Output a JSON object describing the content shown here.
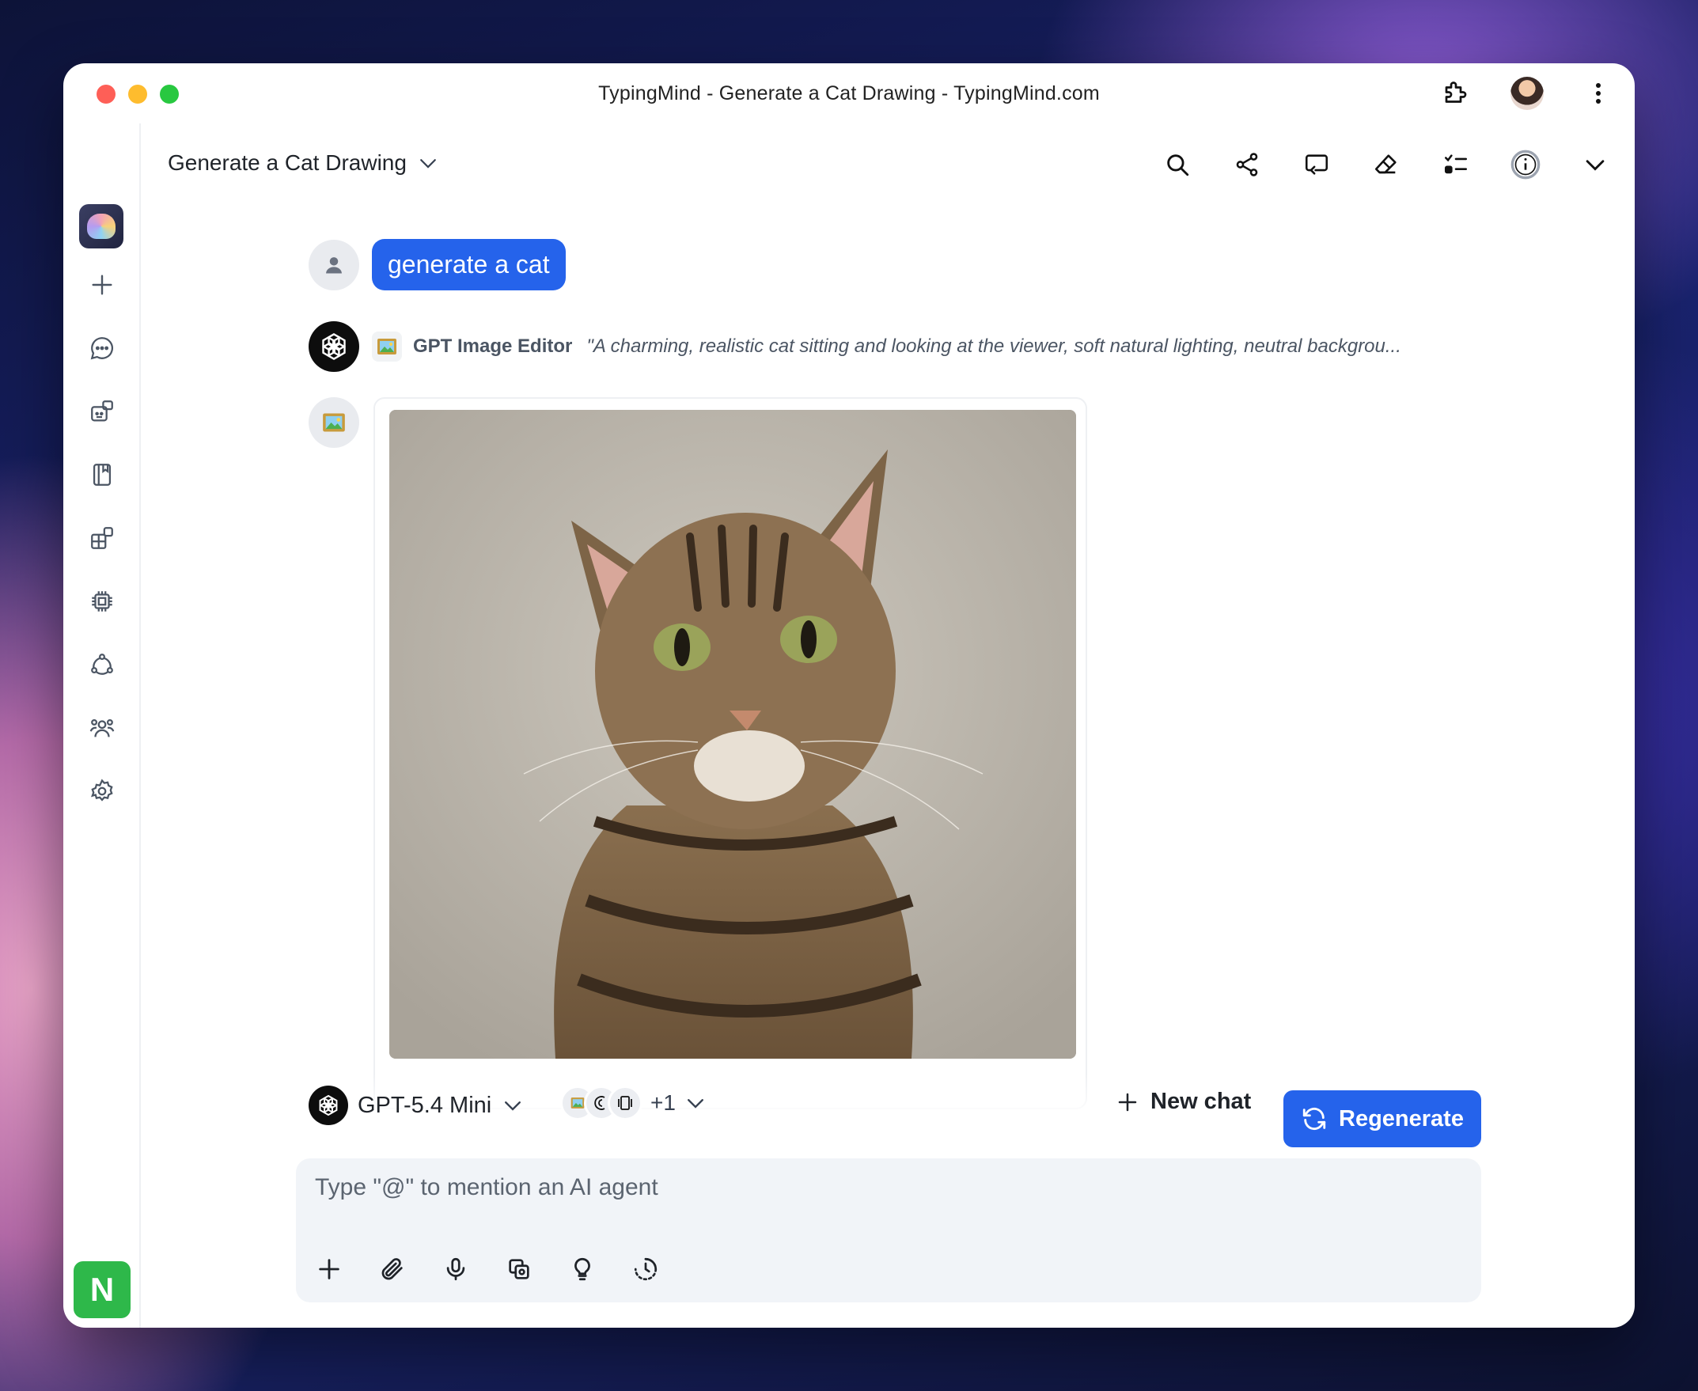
{
  "window": {
    "title": "TypingMind - Generate a Cat Drawing - TypingMind.com"
  },
  "titlebar_icons": [
    "extension-icon",
    "profile-avatar",
    "more-vertical-icon"
  ],
  "sidebar": {
    "items": [
      {
        "name": "new-chat-icon"
      },
      {
        "name": "chats-icon"
      },
      {
        "name": "agents-icon"
      },
      {
        "name": "prompt-library-icon"
      },
      {
        "name": "plugins-icon"
      },
      {
        "name": "models-icon"
      },
      {
        "name": "workflows-icon"
      },
      {
        "name": "team-icon"
      },
      {
        "name": "settings-icon"
      }
    ],
    "user_initial": "N",
    "user_color": "#2eb84a"
  },
  "header": {
    "chat_title": "Generate a Cat Drawing",
    "tools": [
      "search-icon",
      "share-icon",
      "reply-icon",
      "eraser-icon",
      "checklist-icon",
      "info-icon",
      "chevron-down-icon"
    ]
  },
  "messages": {
    "user_text": "generate a cat",
    "tool_name": "GPT Image Editor",
    "tool_args": "\"A charming, realistic cat sitting and looking at the viewer, soft natural lighting, neutral backgrou..."
  },
  "bottom": {
    "model_name": "GPT-5.4 Mini",
    "plugins_more": "+1",
    "new_chat_label": "New chat",
    "regenerate_label": "Regenerate",
    "composer_placeholder": "Type \"@\" to mention an AI agent"
  },
  "colors": {
    "accent": "#2563eb",
    "composer_bg": "#f1f4f8"
  }
}
